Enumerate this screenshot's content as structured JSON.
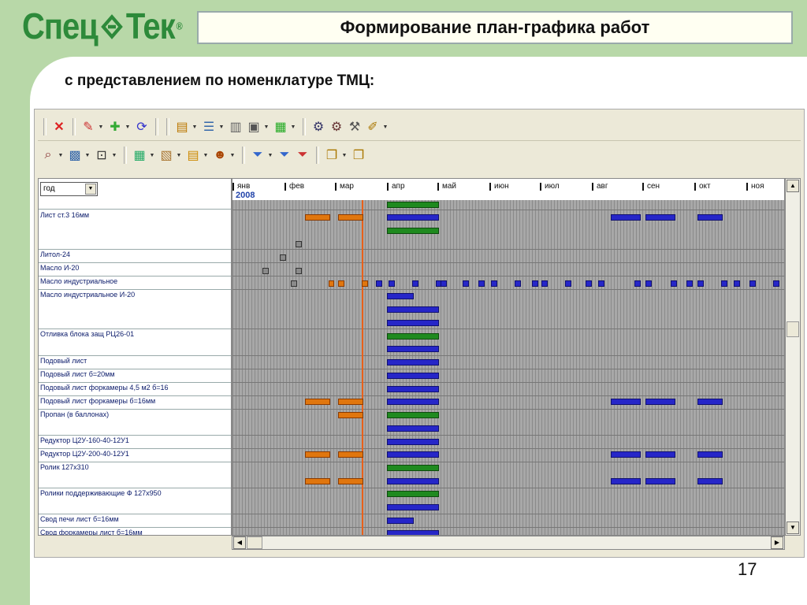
{
  "logo": {
    "left": "Спец",
    "right": "Тек",
    "reg": "®"
  },
  "slide_title": "Формирование план-графика работ",
  "subtitle": "с представлением по номенклатуре ТМЦ:",
  "page_number": "17",
  "period_select": {
    "value": "год"
  },
  "timeline": {
    "year": "2008",
    "months": [
      "янв",
      "фев",
      "мар",
      "апр",
      "май",
      "июн",
      "июл",
      "авг",
      "сен",
      "окт",
      "ноя"
    ]
  },
  "items": [
    "Лист ст.3 16мм",
    "Литол-24",
    "Масло И-20",
    "Масло индустриальное",
    "Масло индустриальное И-20",
    "Отливка блока защ РЦ26-01",
    "Подовый лист",
    "Подовый лист б=20мм",
    "Подовый лист форкамеры 4,5 м2 б=16",
    "Подовый лист форкамеры б=16мм",
    "Пропан (в баллонах)",
    "Редуктор Ц2У-160-40-12У1",
    "Редуктор Ц2У-200-40-12У1",
    "Ролик 127х310",
    "Ролики поддерживающие Ф 127х950",
    "Свод печи лист б=16мм",
    "Свод форкамеры лист б=16мм"
  ],
  "toolbar1_icons": [
    "close-icon",
    "edit-icon",
    "add-icon",
    "refresh-icon",
    "document-edit-icon",
    "list-icon",
    "report-icon",
    "print-icon",
    "export-icon",
    "settings-icon",
    "settings2-icon",
    "tools-icon",
    "edit-doc-icon"
  ],
  "toolbar2_icons": [
    "search-icon",
    "data-icon",
    "frame-icon",
    "calendar-icon",
    "box-icon",
    "table-icon",
    "user-icon",
    "filter-icon",
    "filter-next-icon",
    "filter-clear-icon",
    "window-icon",
    "window2-icon"
  ],
  "colors": {
    "green_bg": "#b8d8a8",
    "brand": "#2d8a3a",
    "bar_blue": "#2626c8",
    "bar_green": "#1f8a1f",
    "bar_orange": "#e0760e",
    "today_line": "#e8601a"
  }
}
